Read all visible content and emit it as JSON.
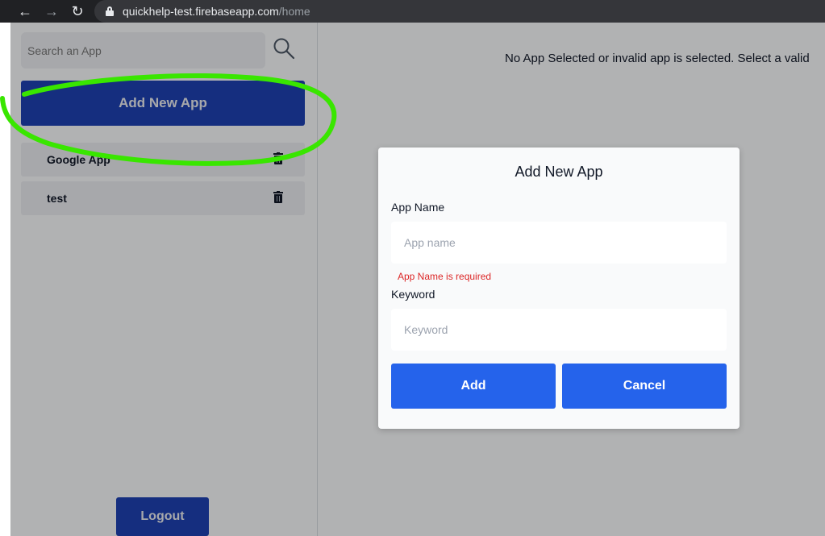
{
  "browser": {
    "url_host": "quickhelp-test.firebaseapp.com",
    "url_path": "/home"
  },
  "sidebar": {
    "search_placeholder": "Search an App",
    "add_button": "Add New App",
    "apps": [
      {
        "label": "Google App"
      },
      {
        "label": "test"
      }
    ],
    "logout_button": "Logout"
  },
  "main": {
    "message": "No App Selected or invalid app is selected. Select a valid"
  },
  "modal": {
    "title": "Add New App",
    "app_name_label": "App Name",
    "app_name_placeholder": "App name",
    "app_name_error": "App Name is required",
    "keyword_label": "Keyword",
    "keyword_placeholder": "Keyword",
    "add_button": "Add",
    "cancel_button": "Cancel"
  },
  "colors": {
    "primary_dark": "#1e40af",
    "primary": "#2563eb",
    "error": "#dc2626",
    "annotation": "#39e600"
  }
}
